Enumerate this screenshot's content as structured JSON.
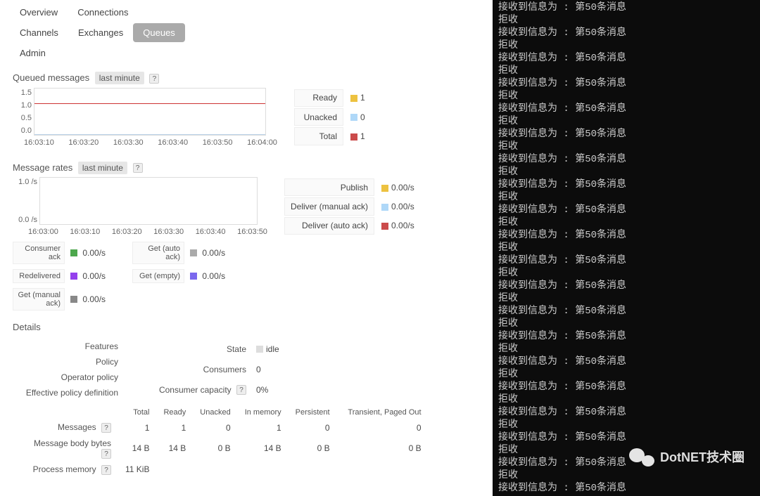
{
  "tabs": {
    "row1": [
      "Overview",
      "Connections"
    ],
    "row2": [
      "Channels",
      "Exchanges",
      "Queues"
    ],
    "row3": [
      "Admin"
    ],
    "active": "Queues"
  },
  "queued": {
    "title": "Queued messages",
    "interval": "last minute",
    "legend": [
      {
        "label": "Ready",
        "swatch": "#edc240",
        "value": "1"
      },
      {
        "label": "Unacked",
        "swatch": "#afd8f8",
        "value": "0"
      },
      {
        "label": "Total",
        "swatch": "#cb4b4b",
        "value": "1"
      }
    ]
  },
  "rates": {
    "title": "Message rates",
    "interval": "last minute",
    "legend": [
      {
        "label": "Publish",
        "swatch": "#edc240",
        "value": "0.00/s"
      },
      {
        "label": "Deliver (manual ack)",
        "swatch": "#afd8f8",
        "value": "0.00/s"
      },
      {
        "label": "Deliver (auto ack)",
        "swatch": "#cb4b4b",
        "value": "0.00/s"
      }
    ],
    "extra": [
      {
        "label": "Consumer ack",
        "swatch": "#4da74d",
        "value": "0.00/s"
      },
      {
        "label": "Redelivered",
        "swatch": "#9440ed",
        "value": "0.00/s"
      },
      {
        "label": "Get (manual ack)",
        "swatch": "#888888",
        "value": "0.00/s"
      },
      {
        "label": "Get (auto ack)",
        "swatch": "#aaaaaa",
        "value": "0.00/s"
      },
      {
        "label": "Get (empty)",
        "swatch": "#7b68ee",
        "value": "0.00/s"
      }
    ]
  },
  "details": {
    "title": "Details",
    "left": [
      {
        "k": "Features",
        "v": ""
      },
      {
        "k": "Policy",
        "v": ""
      },
      {
        "k": "Operator policy",
        "v": ""
      },
      {
        "k": "Effective policy definition",
        "v": ""
      }
    ],
    "right": [
      {
        "k": "State",
        "v": "idle",
        "idle": true
      },
      {
        "k": "Consumers",
        "v": "0"
      },
      {
        "k": "Consumer capacity",
        "v": "0%",
        "help": true
      }
    ]
  },
  "mem": {
    "headers": [
      "",
      "Total",
      "Ready",
      "Unacked",
      "In memory",
      "Persistent",
      "Transient, Paged Out"
    ],
    "rows": [
      {
        "k": "Messages",
        "help": true,
        "cells": [
          "1",
          "1",
          "0",
          "1",
          "0",
          "0"
        ]
      },
      {
        "k": "Message body bytes",
        "help": true,
        "cells": [
          "14 B",
          "14 B",
          "0 B",
          "14 B",
          "0 B",
          "0 B"
        ]
      },
      {
        "k": "Process memory",
        "help": true,
        "cells": [
          "11 KiB",
          "",
          "",
          "",
          "",
          ""
        ]
      }
    ]
  },
  "chart_data": [
    {
      "type": "line",
      "title": "Queued messages",
      "x_ticks": [
        "16:03:10",
        "16:03:20",
        "16:03:30",
        "16:03:40",
        "16:03:50",
        "16:04:00"
      ],
      "y_ticks": [
        "0.0",
        "0.5",
        "1.0",
        "1.5"
      ],
      "ylim": [
        0,
        1.5
      ],
      "series": [
        {
          "name": "Total",
          "color": "#cb4b4b",
          "values": [
            1,
            1,
            1,
            1,
            1,
            1
          ]
        },
        {
          "name": "Unacked",
          "color": "#afd8f8",
          "values": [
            0,
            0,
            0,
            0,
            0,
            0
          ]
        }
      ]
    },
    {
      "type": "line",
      "title": "Message rates",
      "x_ticks": [
        "16:03:00",
        "16:03:10",
        "16:03:20",
        "16:03:30",
        "16:03:40",
        "16:03:50"
      ],
      "y_ticks": [
        "0.0 /s",
        "1.0 /s"
      ],
      "ylim": [
        0,
        1
      ],
      "series": [
        {
          "name": "Publish",
          "color": "#edc240",
          "values": [
            0,
            0,
            0,
            0,
            0,
            0
          ]
        }
      ]
    }
  ],
  "console": {
    "msg": "接收到信息为 : 第50条消息",
    "rej": "拒收",
    "pairs": 19
  },
  "watermark": "DotNET技术圈"
}
